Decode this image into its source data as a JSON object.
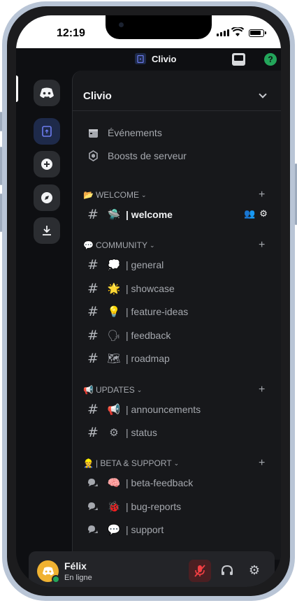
{
  "status_bar": {
    "time": "12:19"
  },
  "top_bar": {
    "title": "Clivio",
    "inbox_icon": "inbox-icon",
    "help_label": "?"
  },
  "server": {
    "name": "Clivio"
  },
  "quick_items": [
    {
      "label": "Événements",
      "icon": "calendar-icon"
    },
    {
      "label": "Boosts de serveur",
      "icon": "boost-icon"
    }
  ],
  "categories": [
    {
      "name": "WELCOME",
      "emoji": "📂"
    },
    {
      "name": "COMMUNITY",
      "emoji": "💬"
    },
    {
      "name": "UPDATES",
      "emoji": "📢"
    },
    {
      "name": "| BETA & SUPPORT",
      "emoji": "👷"
    }
  ],
  "channels": {
    "welcome": [
      {
        "emoji": "🛸",
        "name": "| welcome"
      }
    ],
    "community": [
      {
        "emoji": "💭",
        "name": "| general"
      },
      {
        "emoji": "🌟",
        "name": "| showcase"
      },
      {
        "emoji": "💡",
        "name": "| feature-ideas"
      },
      {
        "emoji": "🗣",
        "name": "| feedback"
      },
      {
        "emoji": "🗺",
        "name": "| roadmap"
      }
    ],
    "updates": [
      {
        "emoji": "📢",
        "name": "| announcements"
      },
      {
        "emoji": "⚙",
        "name": "| status"
      }
    ],
    "beta": [
      {
        "emoji": "🧠",
        "name": "| beta-feedback"
      },
      {
        "emoji": "🐞",
        "name": "| bug-reports"
      },
      {
        "emoji": "💬",
        "name": "| support"
      }
    ]
  },
  "user": {
    "name": "Félix",
    "status": "En ligne"
  },
  "colors": {
    "accent": "#5865f2",
    "online": "#23a55a",
    "muted_bg": "#4a1f22"
  }
}
